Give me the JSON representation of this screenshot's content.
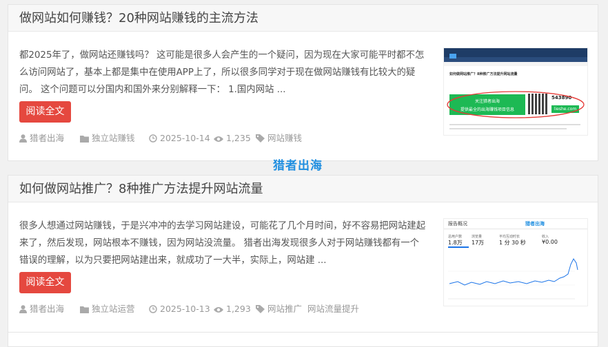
{
  "posts": [
    {
      "title": "做网站如何赚钱？20种网站赚钱的主流方法",
      "excerpt": "都2025年了，做网站还赚钱吗？ 这可能是很多人会产生的一个疑问，因为现在大家可能平时都不怎么访问网站了，基本上都是集中在使用APP上了，所以很多同学对于现在做网站赚钱有比较大的疑问。 这个问题可以分国内和国外来分别解释一下： 1.国内网站 ...",
      "read_more": "阅读全文",
      "author": "猎者出海",
      "category": "独立站赚钱",
      "date": "2025-10-14",
      "views": "1,235",
      "tags": [
        "网站赚钱"
      ],
      "thumb": {
        "heading": "如何做网站推广？8种推广方法提升网站流量",
        "banner_line1": "关注猎者出海",
        "banner_line2": "提供最全的出海赚钱项目信息",
        "wx_id": "543890",
        "site": "lieshe.com"
      }
    },
    {
      "title": "如何做网站推广？8种推广方法提升网站流量",
      "excerpt": "很多人想通过网站赚钱，于是兴冲冲的去学习网站建设，可能花了几个月时间，好不容易把网站建起来了，然后发现，网站根本不赚钱，因为网站没流量。 猎者出海发现很多人对于网站赚钱都有一个错误的理解，以为只要把网站建出来，就成功了一大半，实际上，网站建 ...",
      "read_more": "阅读全文",
      "author": "猎者出海",
      "category": "独立站运营",
      "date": "2025-10-13",
      "views": "1,293",
      "tags": [
        "网站推广",
        "网站流量提升"
      ],
      "thumb": {
        "heading": "报告概况",
        "watermark": "猎者出海",
        "stats": [
          {
            "label": "总用户数",
            "value": "1.8万"
          },
          {
            "label": "浏览量",
            "value": "17万"
          },
          {
            "label": "平均互动时长",
            "value": "1 分 30 秒"
          },
          {
            "label": "收入",
            "value": "¥0.00"
          }
        ]
      }
    }
  ],
  "watermark": "猎者出海",
  "colors": {
    "button": "#e5483f",
    "accent": "#1f8ee0",
    "meta": "#999999"
  }
}
